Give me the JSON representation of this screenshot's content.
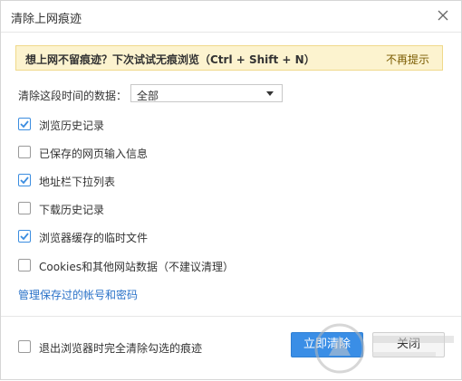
{
  "dialog": {
    "title": "清除上网痕迹",
    "close_icon": "close-icon"
  },
  "tip": {
    "text": "想上网不留痕迹？下次试试无痕浏览（Ctrl + Shift + N）",
    "dismiss_label": "不再提示"
  },
  "range": {
    "label": "清除这段时间的数据：",
    "selected": "全部"
  },
  "options": [
    {
      "label": "浏览历史记录",
      "checked": true
    },
    {
      "label": "已保存的网页输入信息",
      "checked": false
    },
    {
      "label": "地址栏下拉列表",
      "checked": true
    },
    {
      "label": "下载历史记录",
      "checked": false
    },
    {
      "label": "浏览器缓存的临时文件",
      "checked": true
    },
    {
      "label": "Cookies和其他网站数据（不建议清理）",
      "checked": false
    }
  ],
  "manage_link": "管理保存过的帐号和密码",
  "footer": {
    "exit_clear_label": "退出浏览器时完全清除勾选的痕迹",
    "exit_clear_checked": false,
    "primary_button": "立即清除",
    "secondary_button": "关闭"
  },
  "colors": {
    "accent": "#3a8ee6",
    "tip_bg": "#fcf3cf",
    "link": "#2a72c8"
  }
}
